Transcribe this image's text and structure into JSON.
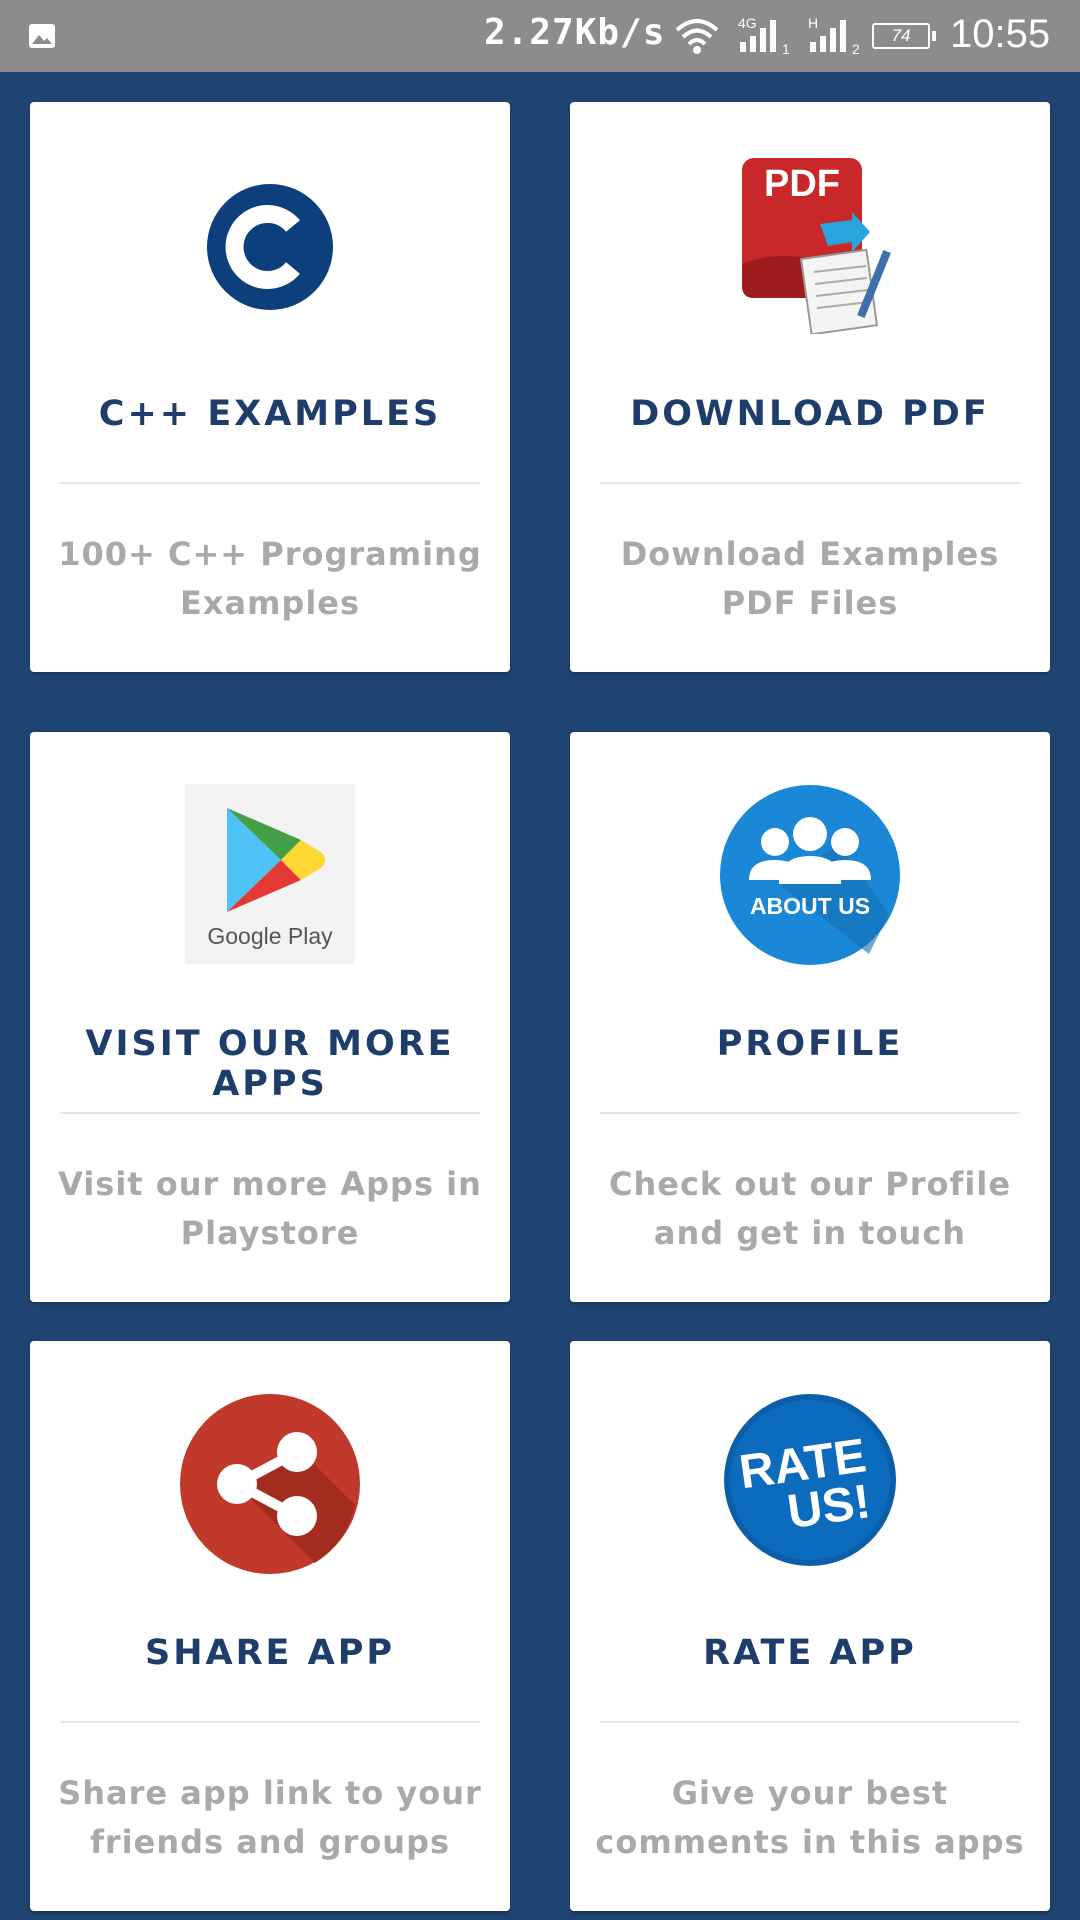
{
  "status_bar": {
    "network_speed": "2.27Kb/s",
    "sim1_label": "4G",
    "sim2_label": "H",
    "battery_level": "74",
    "time": "10:55"
  },
  "colors": {
    "background": "#204472",
    "title": "#1f3d6b",
    "description": "#a9a9a9",
    "share_red": "#c0392b",
    "profile_blue": "#1a88d6",
    "rate_blue": "#0b5fa8"
  },
  "cards": [
    {
      "title": "C++ EXAMPLES",
      "description": "100+ C++ Programing Examples",
      "icon": "c-letter-icon"
    },
    {
      "title": "DOWNLOAD PDF",
      "description": "Download Examples PDF Files",
      "icon": "pdf-document-icon",
      "icon_text": "PDF"
    },
    {
      "title": "VISIT OUR MORE APPS",
      "description": "Visit our more Apps in Playstore",
      "icon": "google-play-icon",
      "icon_text": "Google Play"
    },
    {
      "title": "PROFILE",
      "description": "Check out our Profile and get in touch",
      "icon": "about-us-icon",
      "icon_text": "ABOUT US"
    },
    {
      "title": "SHARE APP",
      "description": "Share app link to your friends and groups",
      "icon": "share-icon"
    },
    {
      "title": "RATE APP",
      "description": "Give your best comments in this apps",
      "icon": "rate-us-icon",
      "icon_text_line1": "RATE",
      "icon_text_line2": "US!"
    }
  ]
}
